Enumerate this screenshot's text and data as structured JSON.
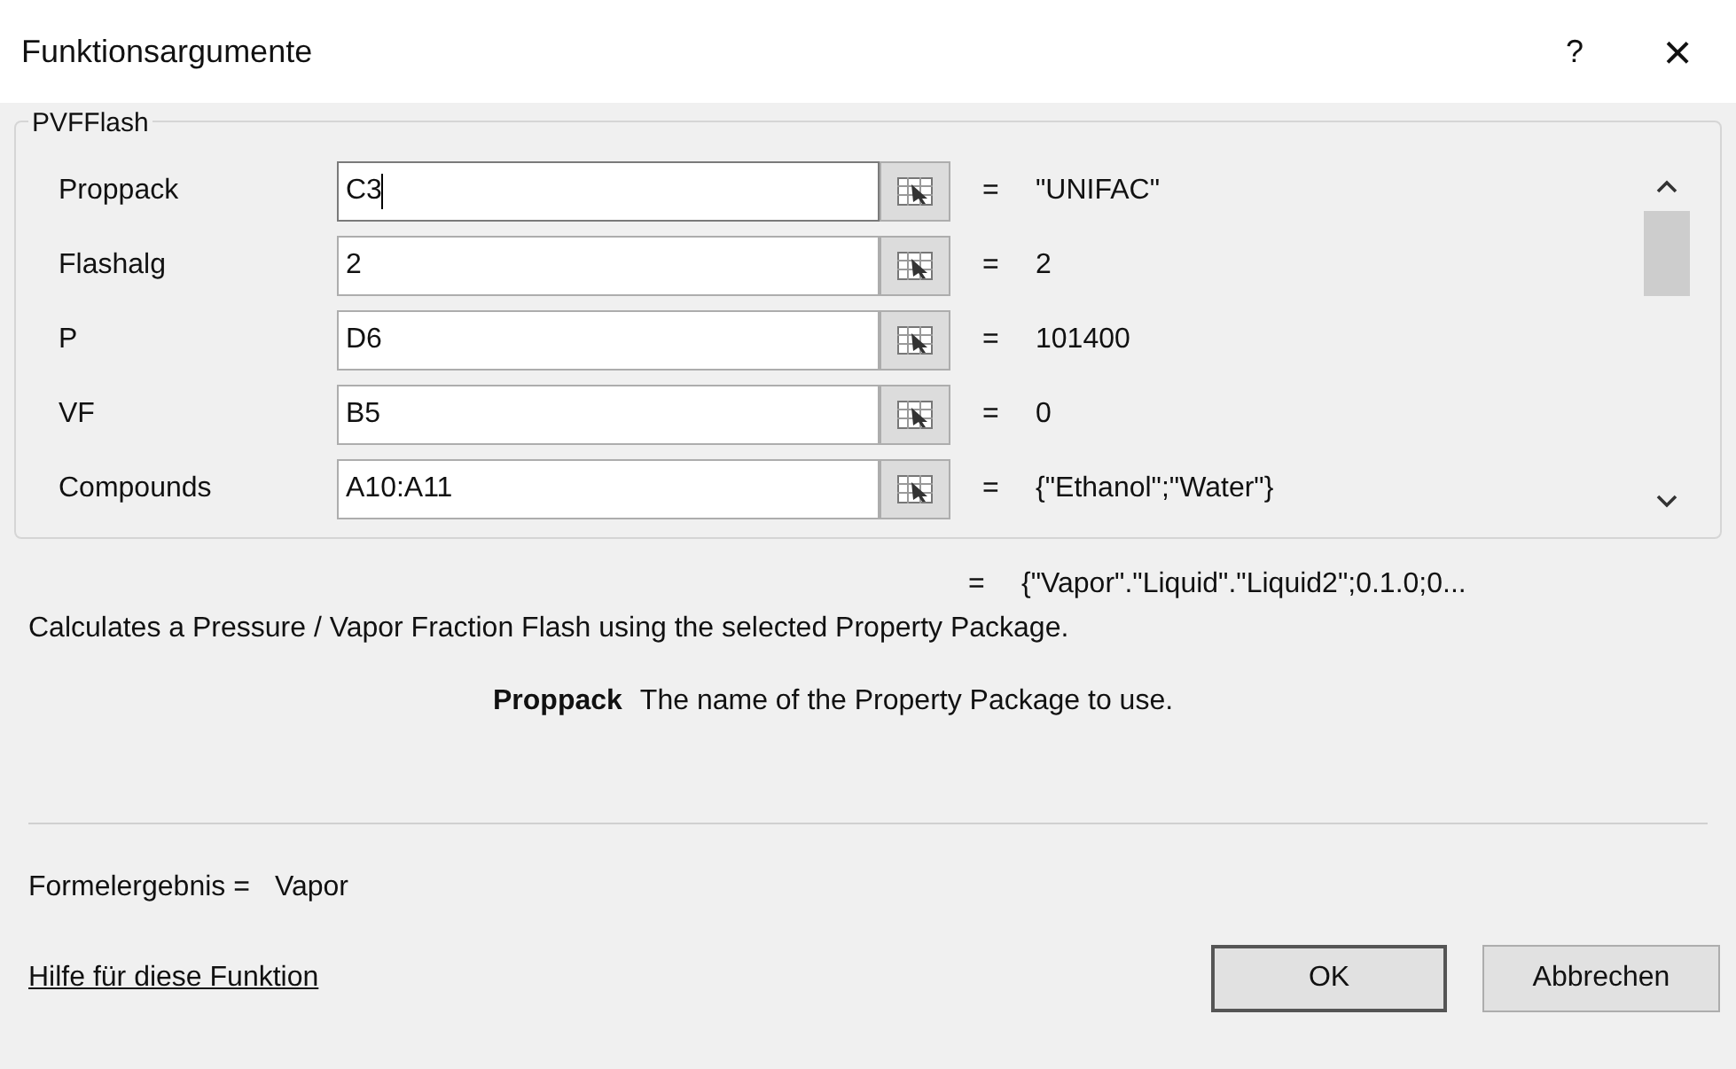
{
  "window": {
    "title": "Funktionsargumente",
    "help": "?",
    "close": "×"
  },
  "group": {
    "title": "PVFFlash",
    "arguments": [
      {
        "label": "Proppack",
        "value": "C3",
        "result": "\"UNIFAC\"",
        "focused": true
      },
      {
        "label": "Flashalg",
        "value": "2",
        "result": "2",
        "focused": false
      },
      {
        "label": "P",
        "value": "D6",
        "result": "101400",
        "focused": false
      },
      {
        "label": "VF",
        "value": "B5",
        "result": "0",
        "focused": false
      },
      {
        "label": "Compounds",
        "value": "A10:A11",
        "result": "{\"Ethanol\";\"Water\"}",
        "focused": false
      }
    ]
  },
  "equals": "=",
  "function_result": "{\"Vapor\".\"Liquid\".\"Liquid2\";0.1.0;0...",
  "description": "Calculates a Pressure / Vapor Fraction Flash using the selected Property Package.",
  "argument_help": {
    "name": "Proppack",
    "text": "The name of the Property Package to use."
  },
  "formula_result": {
    "label": "Formelergebnis =",
    "value": "Vapor"
  },
  "help_link": "Hilfe für diese Funktion",
  "buttons": [
    {
      "label": "OK",
      "default": true
    },
    {
      "label": "Abbrechen",
      "default": false
    }
  ]
}
